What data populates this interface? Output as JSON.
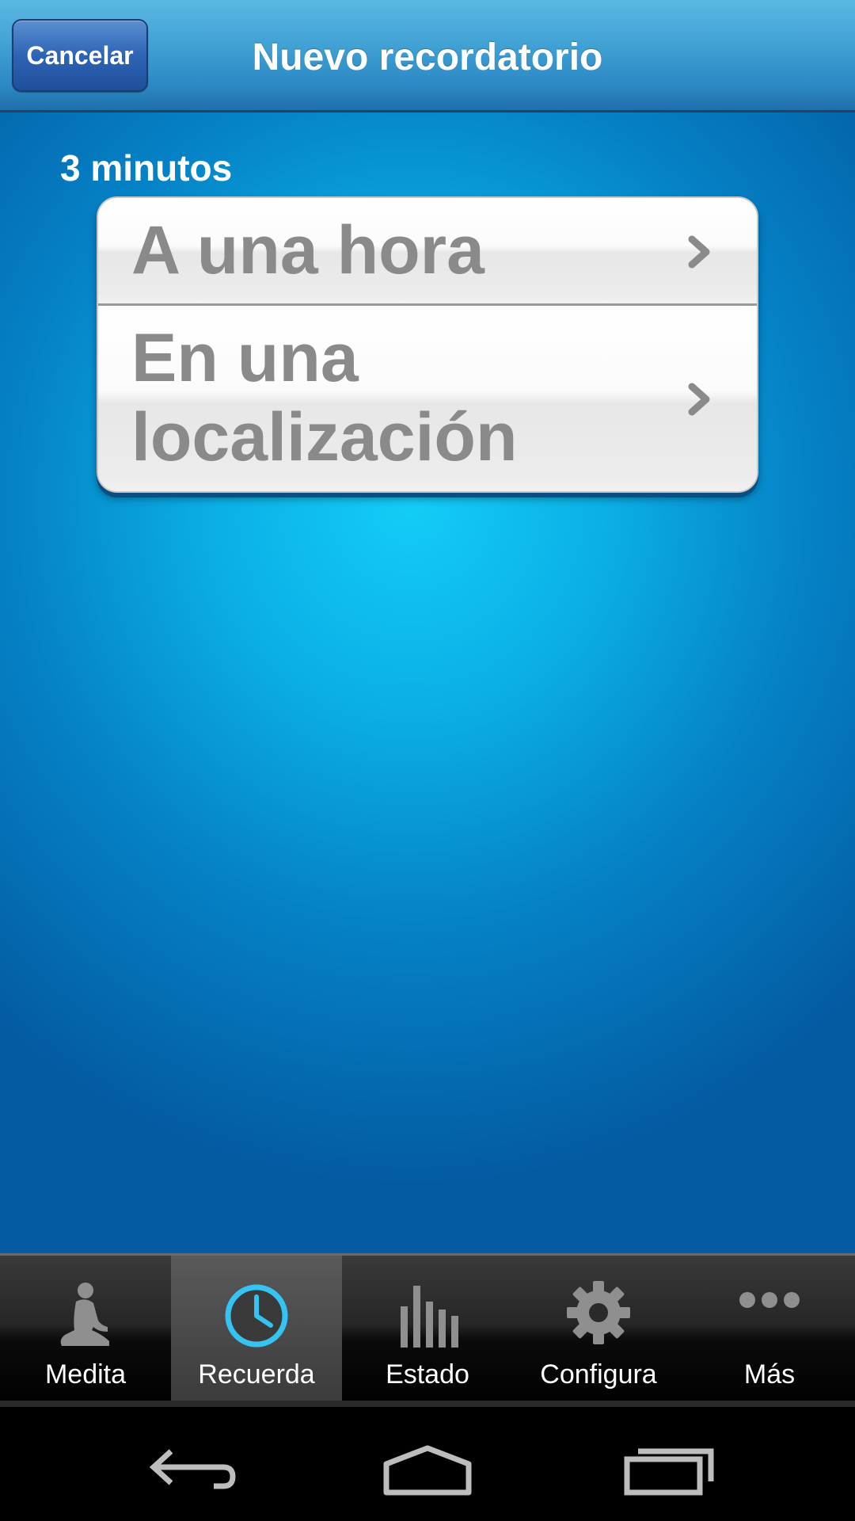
{
  "header": {
    "cancel_label": "Cancelar",
    "title": "Nuevo recordatorio"
  },
  "main": {
    "duration_label": "3 minutos",
    "options": [
      {
        "label": "A una hora",
        "icon": "chevron-right-icon"
      },
      {
        "label": "En una localización",
        "icon": "chevron-right-icon"
      }
    ]
  },
  "tabbar": {
    "active_tab": "Recuerda",
    "tabs": [
      {
        "label": "Medita",
        "icon": "meditation-icon"
      },
      {
        "label": "Recuerda",
        "icon": "clock-icon"
      },
      {
        "label": "Estado",
        "icon": "bar-chart-icon"
      },
      {
        "label": "Configura",
        "icon": "gear-icon"
      },
      {
        "label": "Más",
        "icon": "more-dots-icon"
      }
    ]
  },
  "navbar": {
    "buttons": [
      "back-icon",
      "home-icon",
      "recent-apps-icon"
    ]
  },
  "colors": {
    "header_blue": "#3e9fd3",
    "background_blue": "#0bb0e6",
    "active_tab_icon": "#35c3f2",
    "option_text": "#8a8a8a"
  }
}
